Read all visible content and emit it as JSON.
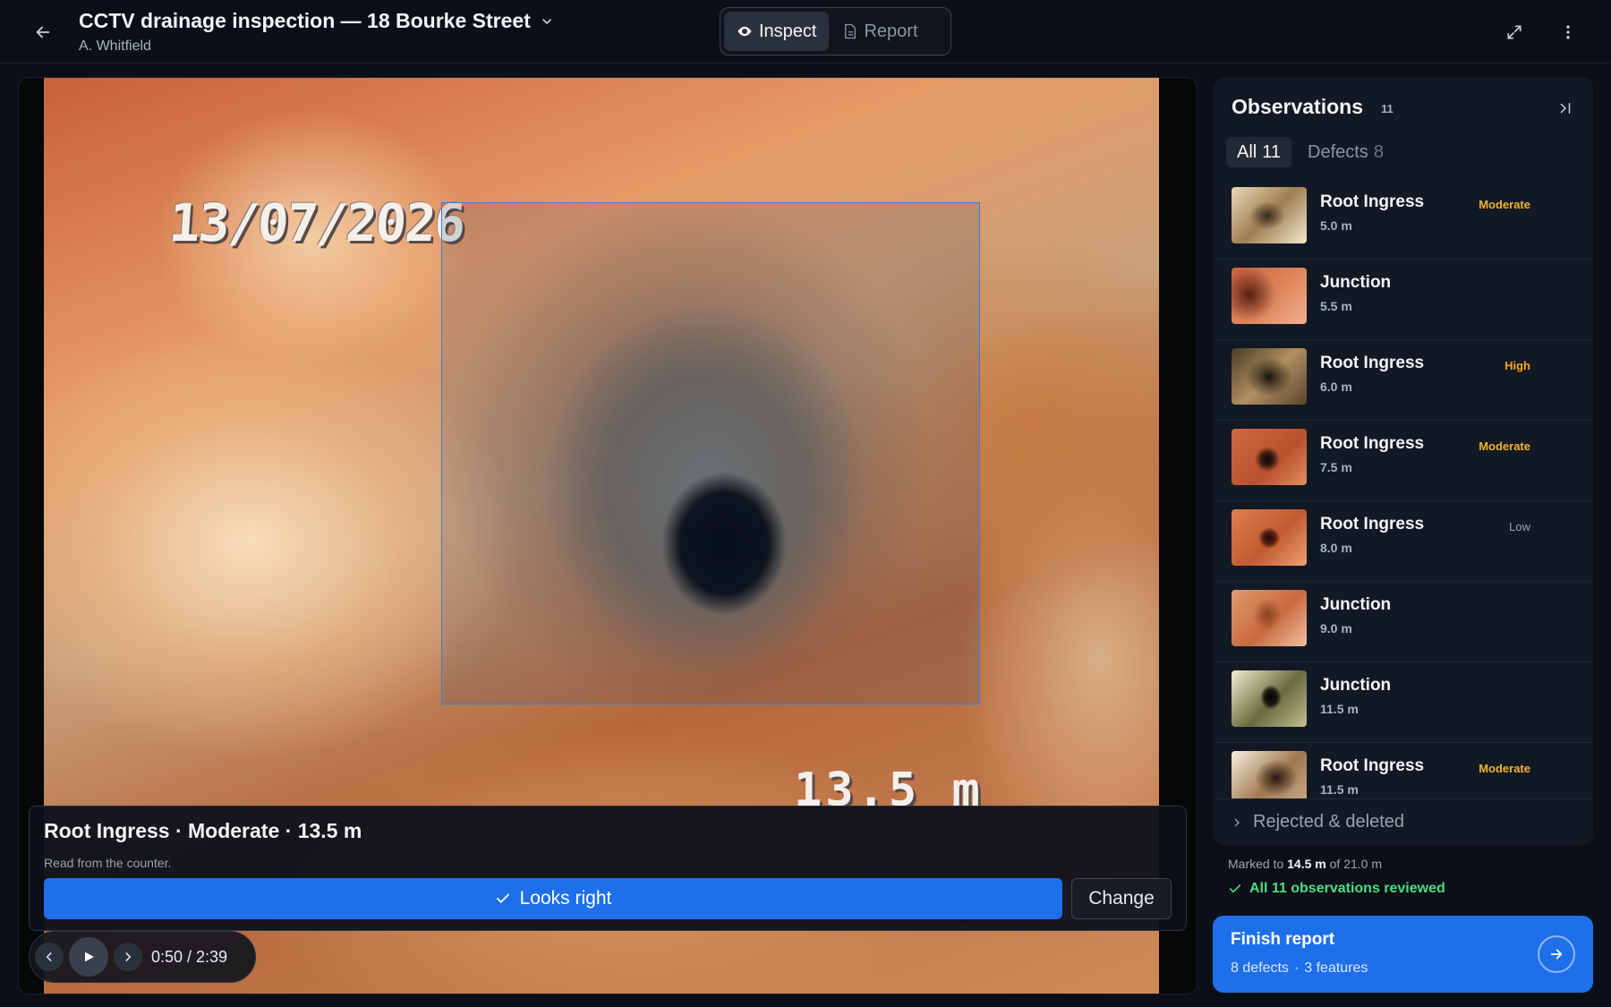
{
  "header": {
    "title": "CCTV drainage inspection — 18 Bourke Street",
    "subtitle": "A. Whitfield",
    "modes": [
      {
        "label": "Inspect",
        "icon": "eye-icon",
        "active": true
      },
      {
        "label": "Report",
        "icon": "document-icon",
        "active": false
      }
    ]
  },
  "video": {
    "osd_date": "13/07/2026",
    "osd_distance": "13.5 m"
  },
  "confirm": {
    "title": "Root Ingress · Moderate · 13.5 m",
    "subtitle": "Read from the counter.",
    "primary_label": "Looks right",
    "secondary_label": "Change"
  },
  "player": {
    "time": "0:50 / 2:39"
  },
  "sidebar": {
    "title": "Observations",
    "count": "11",
    "tabs": [
      {
        "label": "All",
        "count": "11",
        "active": true
      },
      {
        "label": "Defects",
        "count": "8",
        "active": false
      }
    ],
    "items": [
      {
        "name": "Root Ingress",
        "distance": "5.0 m",
        "severity": "Moderate",
        "sev_class": "sev-moderate"
      },
      {
        "name": "Junction",
        "distance": "5.5 m",
        "severity": "",
        "sev_class": ""
      },
      {
        "name": "Root Ingress",
        "distance": "6.0 m",
        "severity": "High",
        "sev_class": "sev-high"
      },
      {
        "name": "Root Ingress",
        "distance": "7.5 m",
        "severity": "Moderate",
        "sev_class": "sev-moderate"
      },
      {
        "name": "Root Ingress",
        "distance": "8.0 m",
        "severity": "Low",
        "sev_class": "sev-low"
      },
      {
        "name": "Junction",
        "distance": "9.0 m",
        "severity": "",
        "sev_class": ""
      },
      {
        "name": "Junction",
        "distance": "11.5 m",
        "severity": "",
        "sev_class": ""
      },
      {
        "name": "Root Ingress",
        "distance": "11.5 m",
        "severity": "Moderate",
        "sev_class": "sev-moderate"
      }
    ],
    "rejected_label": "Rejected & deleted"
  },
  "progress": {
    "prefix": "Marked to",
    "marked": "14.5 m",
    "middle": "of",
    "total": "21.0 m",
    "reviewed": "All 11 observations reviewed"
  },
  "finish": {
    "title": "Finish report",
    "defects": "8 defects",
    "sep": "·",
    "features": "3 features"
  },
  "colors": {
    "accent": "#1f6feb",
    "moderate": "#f0b429",
    "high": "#f5a623",
    "ok": "#4ade80",
    "bbox": "#3a7be0"
  }
}
